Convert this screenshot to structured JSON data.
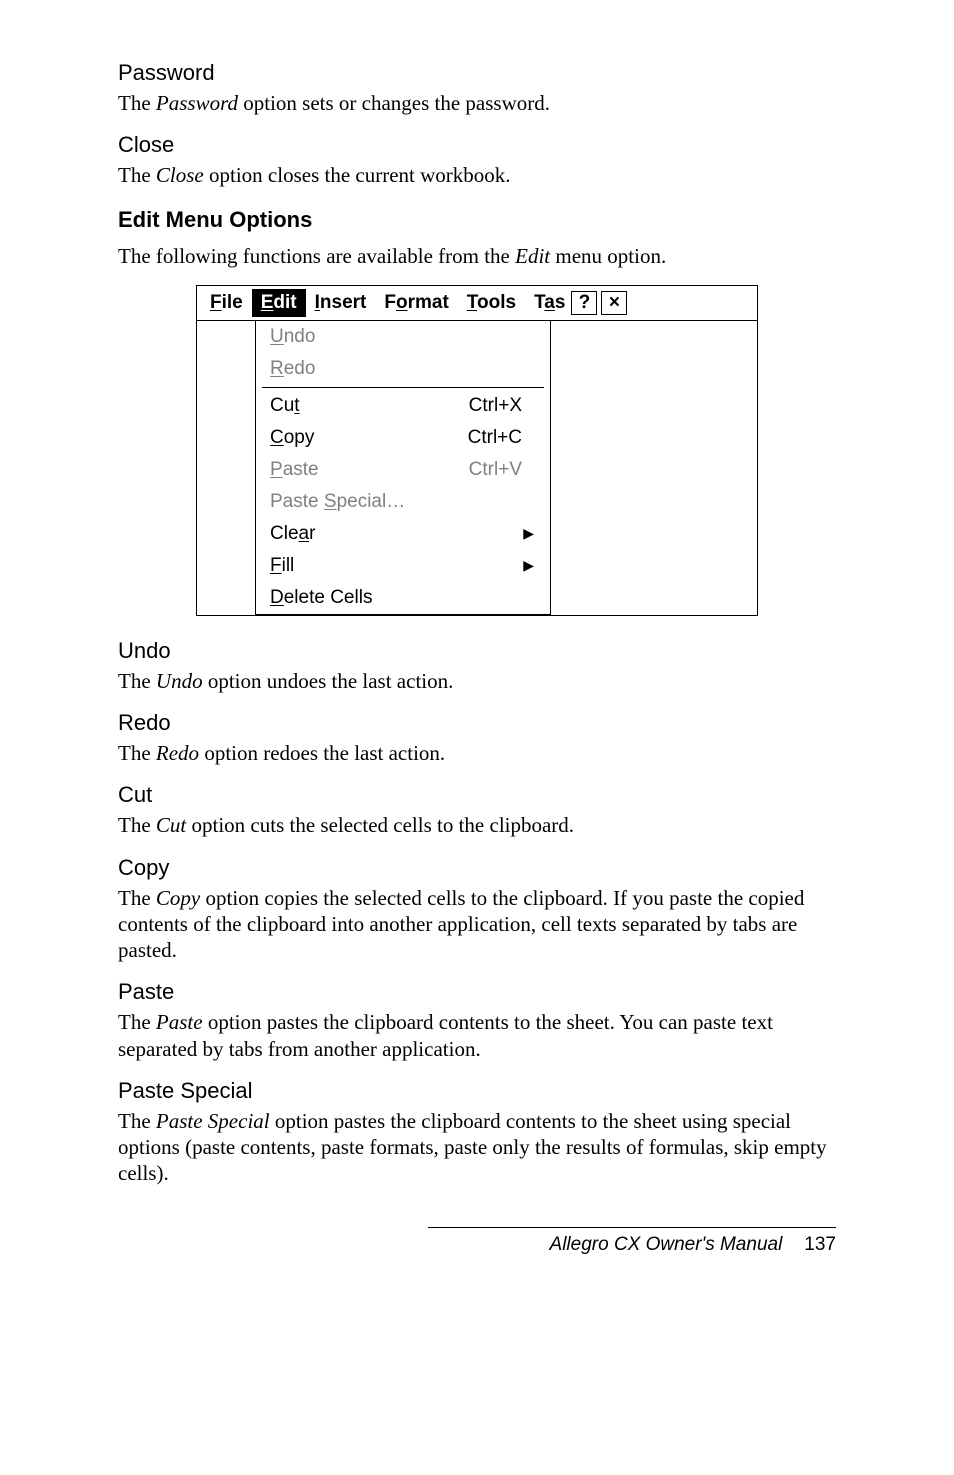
{
  "sections": {
    "password": {
      "heading": "Password",
      "text_a": "The ",
      "text_i": "Password",
      "text_b": " option sets or changes the password."
    },
    "close": {
      "heading": "Close",
      "text_a": "The ",
      "text_i": "Close",
      "text_b": " option closes the current workbook."
    },
    "editmenu": {
      "heading": "Edit Menu Options",
      "text_a": "The following functions are available from the ",
      "text_i": "Edit",
      "text_b": " menu option."
    },
    "undo": {
      "heading": "Undo",
      "text_a": "The ",
      "text_i": "Undo",
      "text_b": " option undoes the last action."
    },
    "redo": {
      "heading": "Redo",
      "text_a": "The ",
      "text_i": "Redo",
      "text_b": " option redoes the last action."
    },
    "cut": {
      "heading": "Cut",
      "text_a": "The ",
      "text_i": "Cut",
      "text_b": " option cuts the selected cells to the clipboard."
    },
    "copy": {
      "heading": "Copy",
      "text_a": "The ",
      "text_i": "Copy",
      "text_b": " option copies the selected cells to the clipboard. If you paste the copied contents of the clipboard into another application, cell texts separated by tabs are pasted."
    },
    "paste": {
      "heading": "Paste",
      "text_a": "The ",
      "text_i": "Paste",
      "text_b": " option pastes the clipboard contents to the sheet. You can paste text separated by tabs from another application."
    },
    "pastespecial": {
      "heading": "Paste Special",
      "text_a": "The ",
      "text_i": "Paste Special",
      "text_b": " option pastes the clipboard contents to the sheet using special options (paste contents, paste formats, paste only the results of formulas, skip empty cells)."
    }
  },
  "menubar": {
    "file": {
      "u": "F",
      "rest": "ile"
    },
    "edit": {
      "u": "E",
      "rest": "dit"
    },
    "insert": {
      "u": "I",
      "rest": "nsert"
    },
    "format_pre": "F",
    "format_u": "o",
    "format_post": "rmat",
    "tools": {
      "u": "T",
      "rest": "ools"
    },
    "tas_pre": "T",
    "tas_u": "a",
    "tas_post": "s",
    "help": "?",
    "close": "×"
  },
  "dropdown": {
    "undo": {
      "u": "U",
      "rest": "ndo"
    },
    "redo": {
      "u": "R",
      "rest": "edo"
    },
    "cut_pre": "Cu",
    "cut_u": "t",
    "cut_sc": "Ctrl+X",
    "copy": {
      "u": "C",
      "rest": "opy",
      "sc": "Ctrl+C"
    },
    "paste": {
      "u": "P",
      "rest": "aste",
      "sc": "Ctrl+V"
    },
    "pastespecial_pre": "Paste ",
    "pastespecial_u": "S",
    "pastespecial_post": "pecial…",
    "clear_pre": "Cle",
    "clear_u": "a",
    "clear_post": "r",
    "fill": {
      "u": "F",
      "rest": "ill"
    },
    "delete": {
      "u": "D",
      "rest": "elete Cells"
    },
    "arrow": "▶"
  },
  "footer": {
    "title": "Allegro CX Owner's Manual",
    "page": "137"
  }
}
